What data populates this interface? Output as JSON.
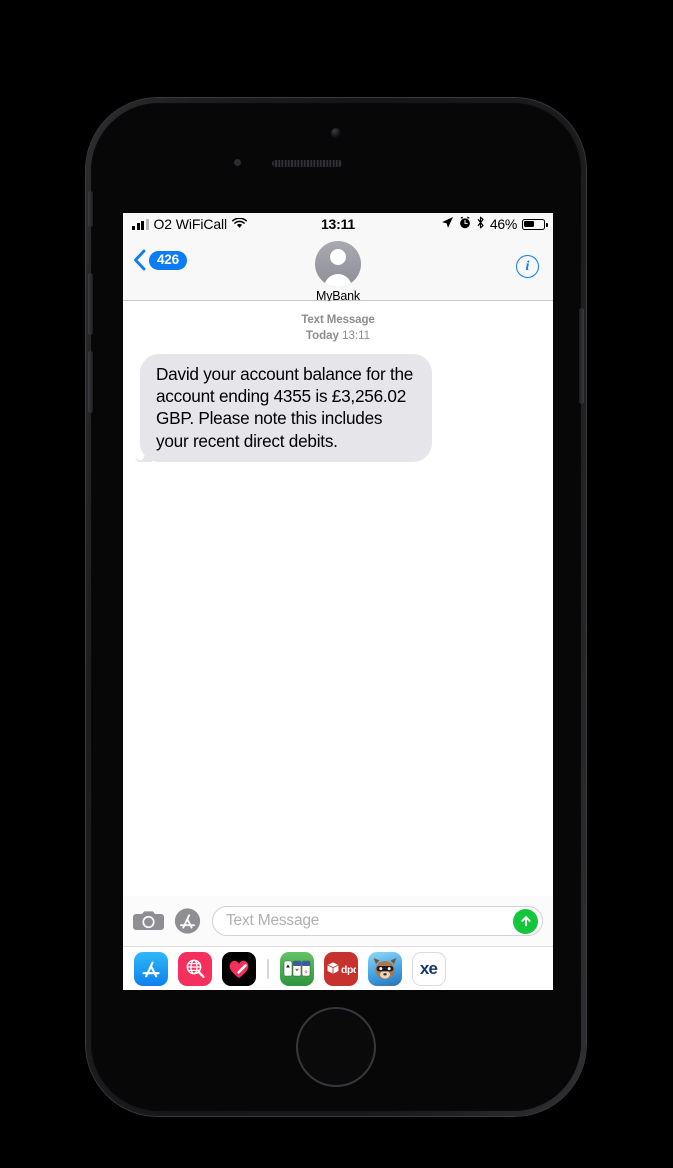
{
  "device": {
    "name": "iphone-8",
    "frame_color": "#141416"
  },
  "status_bar": {
    "carrier": "O2 WiFiCall",
    "signal_bars_filled": 3,
    "signal_bars_total": 4,
    "wifi_icon": "wifi-icon",
    "time": "13:11",
    "location_icon": "location-arrow-icon",
    "alarm_icon": "alarm-clock-icon",
    "bluetooth_icon": "bluetooth-icon",
    "battery_percent": "46%",
    "battery_level": 46
  },
  "nav_bar": {
    "back_icon": "chevron-left-icon",
    "back_badge": "426",
    "avatar_icon": "contact-avatar-placeholder-icon",
    "contact_name": "MyBank",
    "info_icon": "info-circle-icon",
    "info_label": "i",
    "accent_color": "#0b7cf7"
  },
  "conversation": {
    "message_type_label": "Text Message",
    "timestamp_day": "Today",
    "timestamp_time": "13:11",
    "messages": [
      {
        "sender": "MyBank",
        "direction": "incoming",
        "bubble_color": "#e6e5ea",
        "text": "David your account balance for the account ending 4355 is £3,256.02 GBP. Please note this includes your recent direct debits."
      }
    ]
  },
  "composer": {
    "camera_icon": "camera-icon",
    "appstore_icon": "app-store-icon",
    "input_placeholder": "Text Message",
    "input_value": "",
    "send_icon": "arrow-up-icon",
    "send_color": "#14c63c"
  },
  "app_drawer": {
    "apps": [
      {
        "name": "app-store",
        "icon": "app-store-icon",
        "label": "",
        "color": "#0e80ef"
      },
      {
        "name": "image-search",
        "icon": "globe-search-icon",
        "label": "",
        "color": "#f5305c"
      },
      {
        "name": "health",
        "icon": "heart-icon",
        "label": "",
        "color": "#000000"
      },
      {
        "name": "solitaire",
        "icon": "playing-cards-icon",
        "label": "",
        "color": "#2f9440"
      },
      {
        "name": "dpd",
        "icon": "parcel-box-icon",
        "label": "dpd",
        "color": "#c8322e"
      },
      {
        "name": "raccoon-game",
        "icon": "raccoon-avatar-icon",
        "label": "",
        "color": "#3f9fe0"
      },
      {
        "name": "xe-currency",
        "icon": "xe-logo-icon",
        "label": "xe",
        "color": "#17386e"
      }
    ]
  }
}
